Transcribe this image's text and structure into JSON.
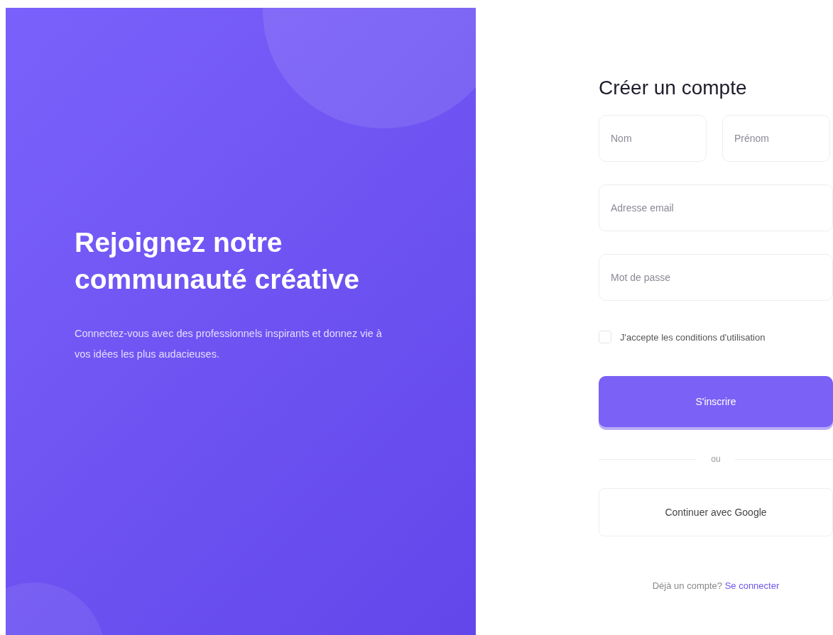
{
  "hero": {
    "title": "Rejoignez notre communauté créative",
    "text": "Connectez-vous avec des professionnels inspirants et donnez vie à vos idées les plus audacieuses."
  },
  "form": {
    "title": "Créer un compte",
    "name_fields": [
      {
        "placeholder": "Nom"
      },
      {
        "placeholder": "Prénom"
      }
    ],
    "fields": [
      {
        "placeholder": "Adresse email"
      },
      {
        "placeholder": "Mot de passe"
      }
    ],
    "terms": {
      "label": "J'accepte les conditions d'utilisation",
      "checked": false
    },
    "submit": "S'inscrire",
    "divider": "ou",
    "google": "Continuer avec Google",
    "footer": {
      "text": "Déjà un compte?",
      "link": "Se connecter"
    }
  }
}
